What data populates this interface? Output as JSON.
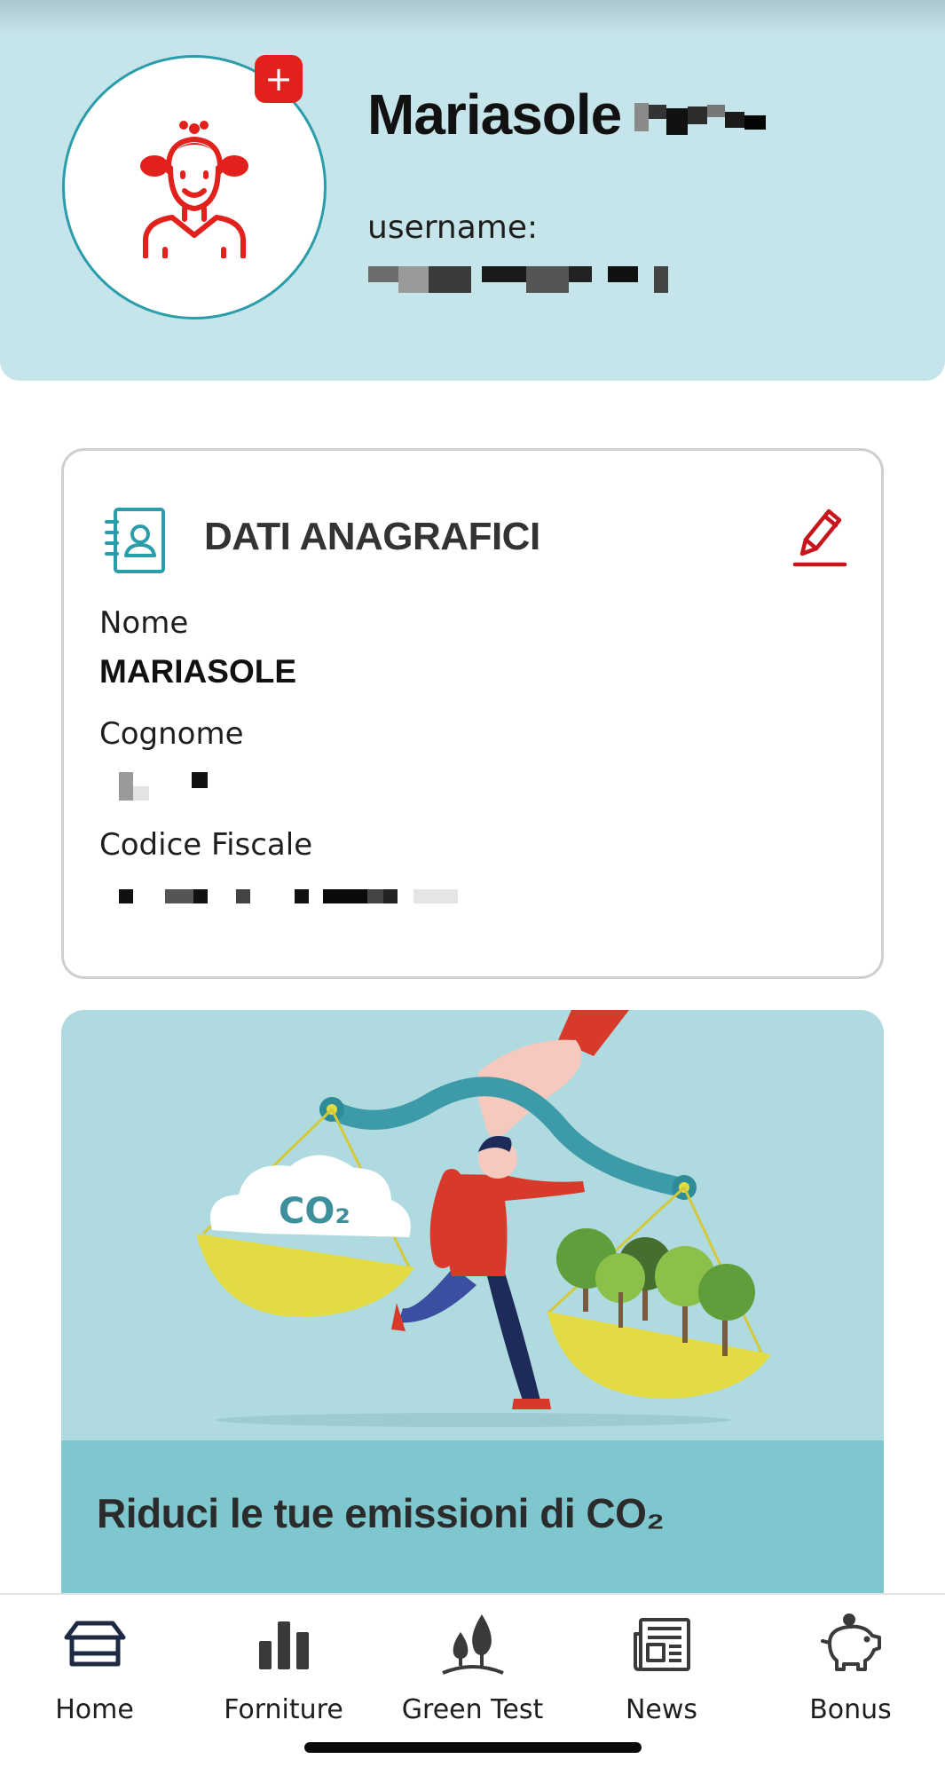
{
  "profile": {
    "name": "Mariasole",
    "username_label": "username:",
    "add_photo_symbol": "+"
  },
  "anagrafica": {
    "title": "DATI ANAGRAFICI",
    "fields": [
      {
        "label": "Nome",
        "value": "MARIASOLE"
      },
      {
        "label": "Cognome"
      },
      {
        "label": "Codice Fiscale"
      }
    ]
  },
  "promo": {
    "title": "Riduci le tue emissioni di CO₂",
    "illustration_text": "CO₂"
  },
  "tabbar": {
    "items": [
      {
        "label": "Home",
        "icon": "home-icon"
      },
      {
        "label": "Forniture",
        "icon": "bar-chart-icon"
      },
      {
        "label": "Green Test",
        "icon": "trees-icon"
      },
      {
        "label": "News",
        "icon": "newspaper-icon"
      },
      {
        "label": "Bonus",
        "icon": "piggy-bank-icon"
      }
    ]
  },
  "colors": {
    "header_bg": "#c6e5eb",
    "accent_red": "#e3211c",
    "accent_teal": "#2a9daa",
    "promo_bg": "#afdbe0",
    "promo_band": "#7fc7cf"
  }
}
